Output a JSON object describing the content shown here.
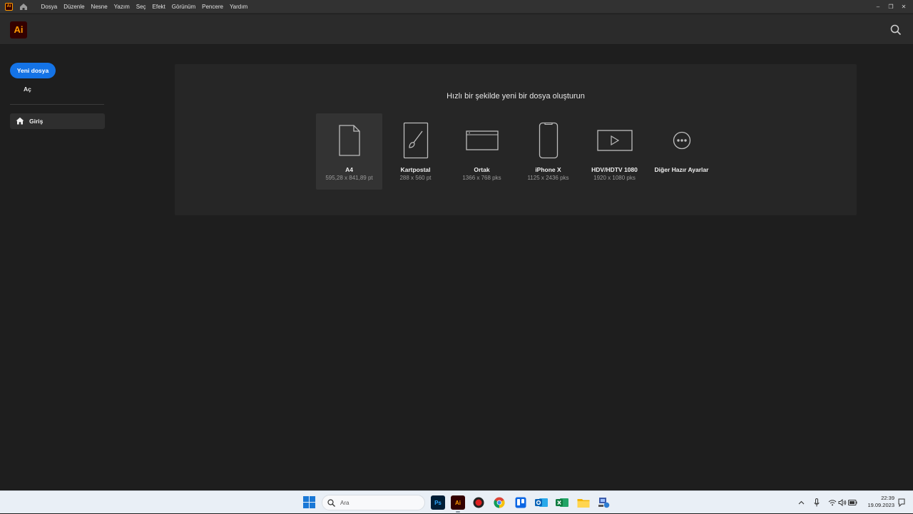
{
  "menubar": {
    "app_icon_text": "Ai",
    "items": [
      "Dosya",
      "Düzenle",
      "Nesne",
      "Yazım",
      "Seç",
      "Efekt",
      "Görünüm",
      "Pencere",
      "Yardım"
    ],
    "window_controls": [
      "–",
      "❐",
      "✕"
    ]
  },
  "header": {
    "logo_text": "Ai"
  },
  "sidebar": {
    "new_file_label": "Yeni dosya",
    "open_label": "Aç",
    "home_label": "Giriş"
  },
  "panel": {
    "title": "Hızlı bir şekilde yeni bir dosya oluşturun",
    "presets": [
      {
        "name": "A4",
        "size": "595,28 x 841,89 pt",
        "icon": "document-icon"
      },
      {
        "name": "Kartpostal",
        "size": "288 x 560 pt",
        "icon": "brush-card-icon"
      },
      {
        "name": "Ortak",
        "size": "1366 x 768 pks",
        "icon": "browser-window-icon"
      },
      {
        "name": "iPhone X",
        "size": "1125 x 2436 pks",
        "icon": "phone-icon"
      },
      {
        "name": "HDV/HDTV 1080",
        "size": "1920 x 1080 pks",
        "icon": "video-play-icon"
      },
      {
        "name": "Diğer Hazır Ayarlar",
        "size": "",
        "icon": "more-icon"
      }
    ]
  },
  "taskbar": {
    "search_placeholder": "Ara",
    "apps": [
      {
        "label": "Ps",
        "name": "photoshop"
      },
      {
        "label": "Ai",
        "name": "illustrator"
      },
      {
        "label": "",
        "name": "recorder"
      },
      {
        "label": "",
        "name": "chrome"
      },
      {
        "label": "",
        "name": "trello"
      },
      {
        "label": "",
        "name": "outlook"
      },
      {
        "label": "",
        "name": "excel"
      },
      {
        "label": "",
        "name": "file-explorer"
      },
      {
        "label": "",
        "name": "network-app"
      }
    ],
    "clock_time": "22:39",
    "clock_date": "19.09.2023"
  },
  "colors": {
    "accent": "#1473e6",
    "ai_brand_bg": "#330000",
    "ai_brand_fg": "#ff9a00"
  }
}
